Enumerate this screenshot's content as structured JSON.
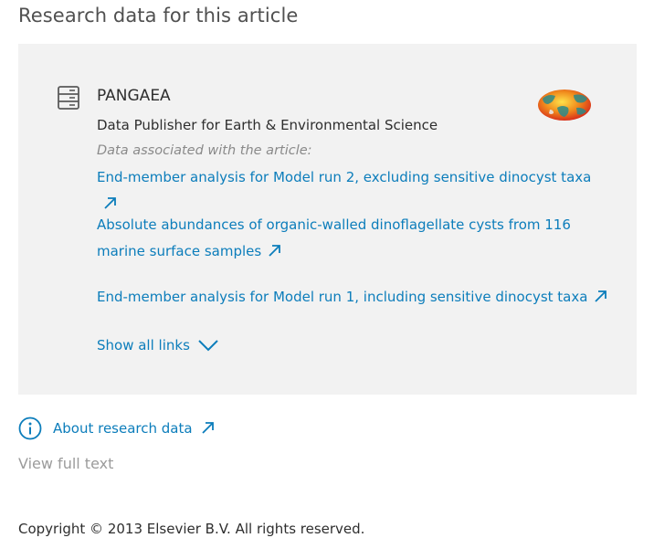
{
  "section": {
    "title": "Research data for this article"
  },
  "repository": {
    "icon": "database-icon",
    "name": "PANGAEA",
    "description": "Data Publisher for Earth & Environmental Science",
    "associated_label": "Data associated with the article:",
    "logo": "pangaea-globe-logo",
    "links": [
      {
        "label": "End-member analysis for Model run 2, excluding sensitive dinocyst taxa",
        "icon": "external-link-arrow-icon"
      },
      {
        "label": "Absolute abundances of organic-walled dinoflagellate cysts from 116 marine surface samples",
        "icon": "external-link-arrow-icon"
      },
      {
        "label": "End-member analysis for Model run 1, including sensitive dinocyst taxa",
        "icon": "external-link-arrow-icon"
      }
    ],
    "show_all_label": "Show all links",
    "show_all_icon": "chevron-down-icon"
  },
  "about": {
    "icon": "info-icon",
    "label": "About research data",
    "link_icon": "external-link-arrow-icon"
  },
  "view_full_text": "View full text",
  "copyright": "Copyright © 2013 Elsevier B.V. All rights reserved.",
  "colors": {
    "link": "#0c7dbb",
    "panel_bg": "#f2f2f2",
    "text": "#2e2e2e",
    "muted": "#8a8a8a"
  }
}
